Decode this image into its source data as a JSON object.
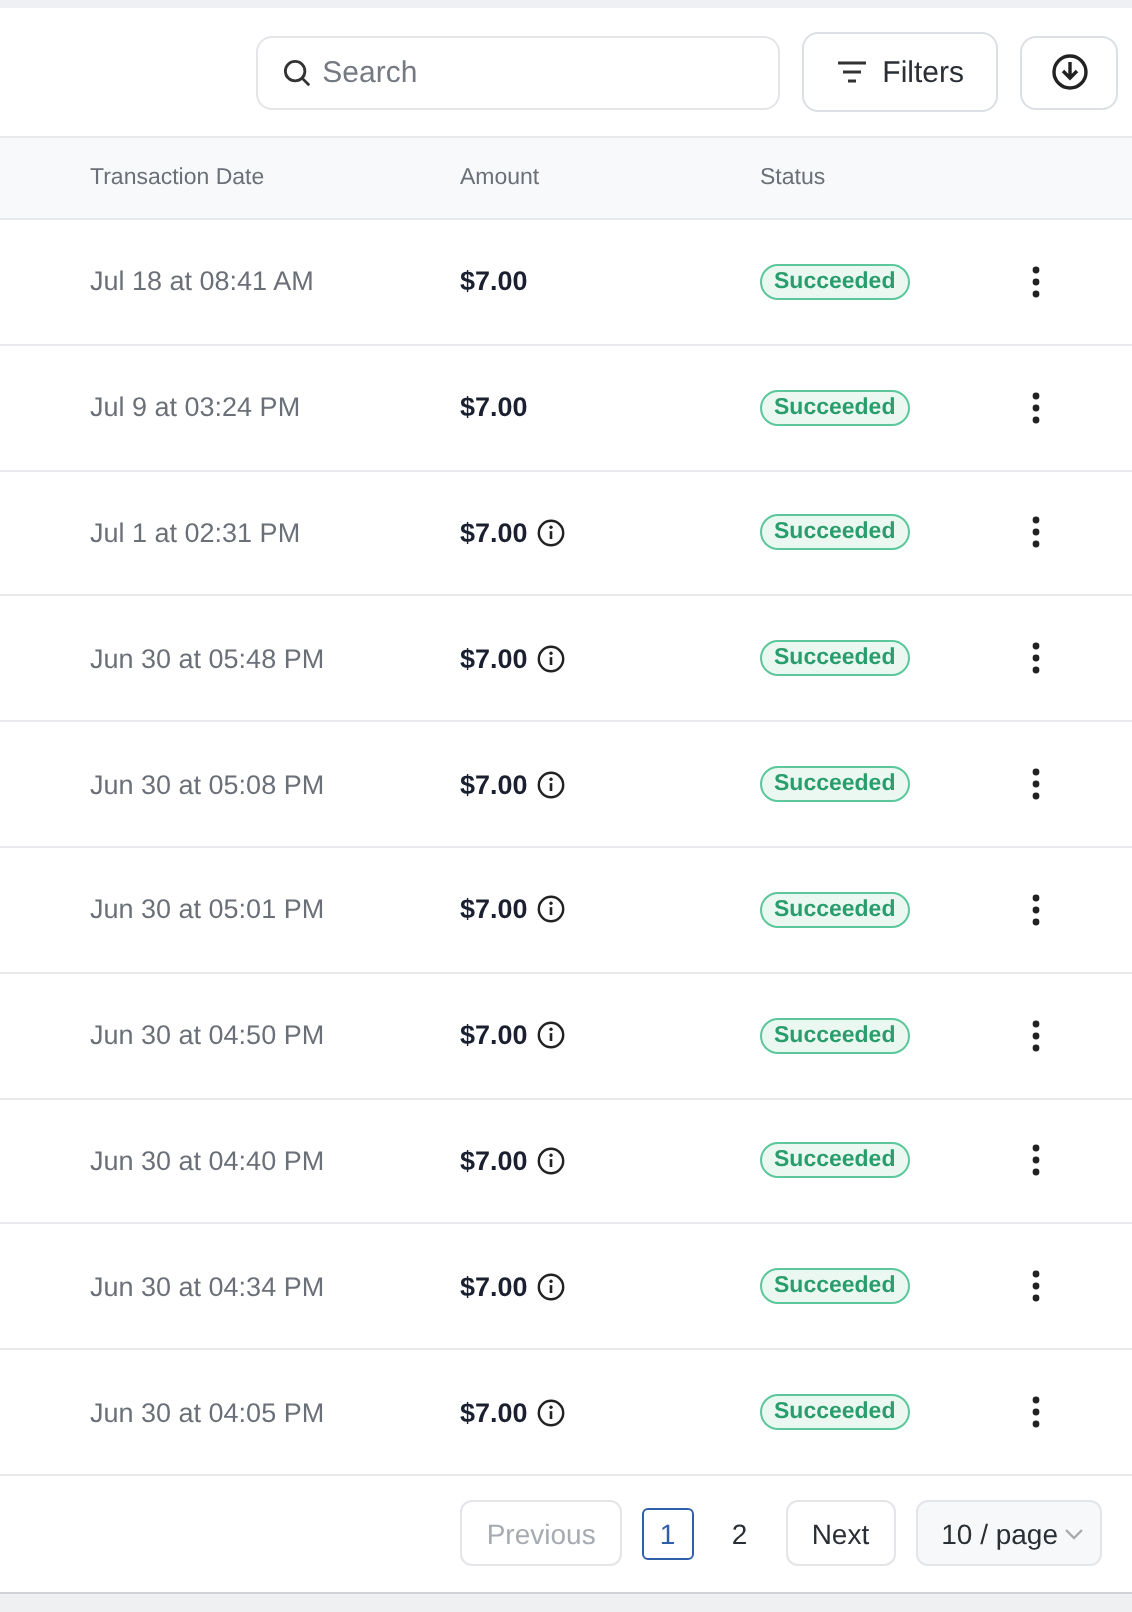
{
  "toolbar": {
    "search": {
      "placeholder": "Search"
    },
    "filters_button": "Filters"
  },
  "table": {
    "columns": [
      "Transaction Date",
      "Amount",
      "Status"
    ],
    "rows": [
      {
        "date": "Jul 18 at 08:41 AM",
        "amount": "$7.00",
        "info": false,
        "status": "Succeeded"
      },
      {
        "date": "Jul 9 at 03:24 PM",
        "amount": "$7.00",
        "info": false,
        "status": "Succeeded"
      },
      {
        "date": "Jul 1 at 02:31 PM",
        "amount": "$7.00",
        "info": true,
        "status": "Succeeded"
      },
      {
        "date": "Jun 30 at 05:48 PM",
        "amount": "$7.00",
        "info": true,
        "status": "Succeeded"
      },
      {
        "date": "Jun 30 at 05:08 PM",
        "amount": "$7.00",
        "info": true,
        "status": "Succeeded"
      },
      {
        "date": "Jun 30 at 05:01 PM",
        "amount": "$7.00",
        "info": true,
        "status": "Succeeded"
      },
      {
        "date": "Jun 30 at 04:50 PM",
        "amount": "$7.00",
        "info": true,
        "status": "Succeeded"
      },
      {
        "date": "Jun 30 at 04:40 PM",
        "amount": "$7.00",
        "info": true,
        "status": "Succeeded"
      },
      {
        "date": "Jun 30 at 04:34 PM",
        "amount": "$7.00",
        "info": true,
        "status": "Succeeded"
      },
      {
        "date": "Jun 30 at 04:05 PM",
        "amount": "$7.00",
        "info": true,
        "status": "Succeeded"
      }
    ]
  },
  "pagination": {
    "previous": {
      "label": "Previous",
      "disabled": true
    },
    "pages": [
      {
        "label": "1",
        "selected": true
      },
      {
        "label": "2",
        "selected": false
      }
    ],
    "next": {
      "label": "Next",
      "disabled": false
    },
    "page_size": "10 / page"
  }
}
